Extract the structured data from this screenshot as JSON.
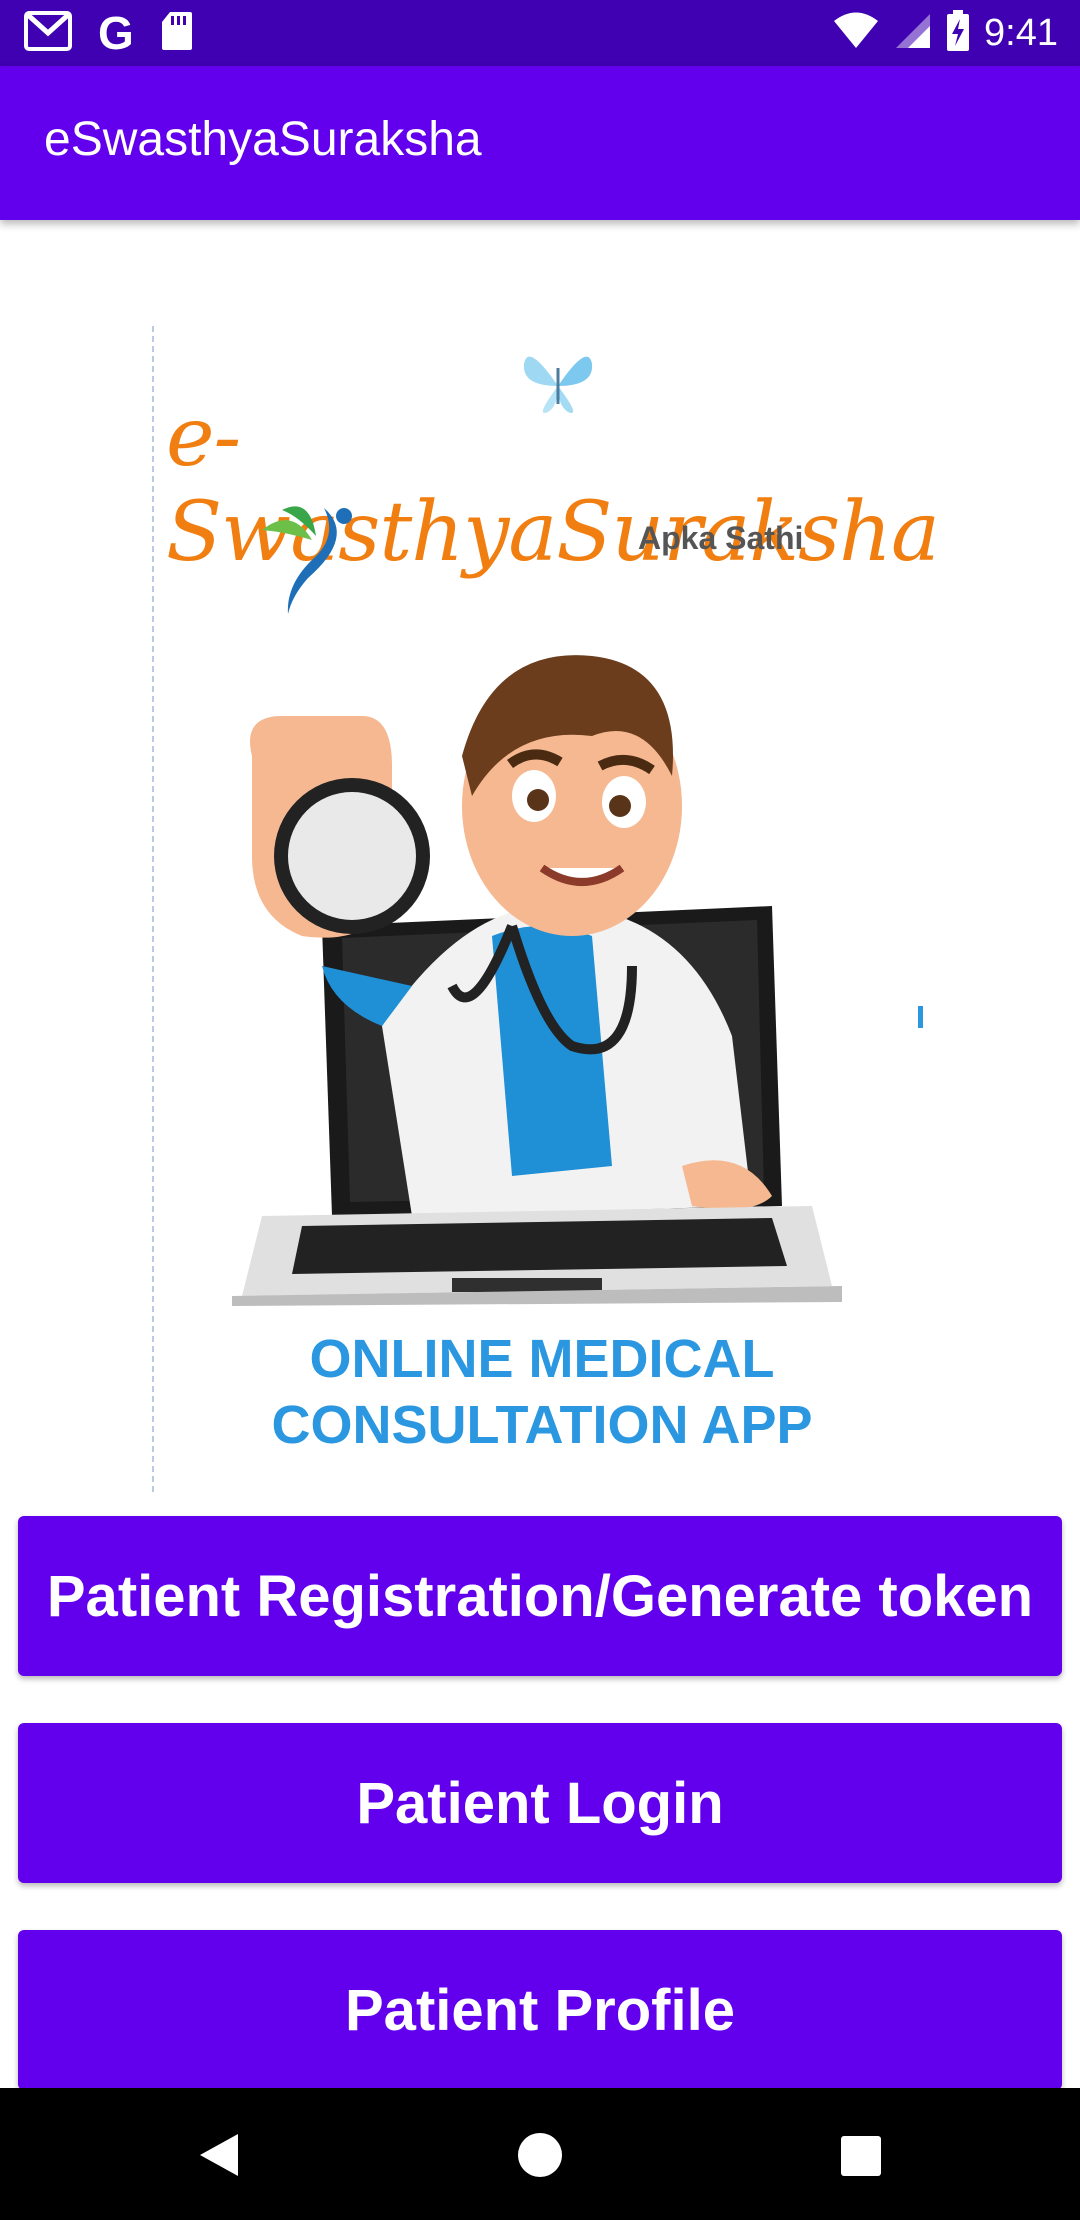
{
  "status_bar": {
    "time": "9:41",
    "left_icons": [
      "gmail-icon",
      "google-icon",
      "sd-card-icon"
    ],
    "right_icons": [
      "wifi-icon",
      "signal-icon",
      "battery-charging-icon"
    ]
  },
  "app_bar": {
    "title": "eSwasthyaSuraksha"
  },
  "splash": {
    "brand": "e-SwasthyaSuraksha",
    "tagline": "Apka Sathi",
    "caption_line1": "ONLINE MEDICAL",
    "caption_line2": "CONSULTATION APP",
    "brand_color": "#f07e10",
    "caption_color": "#2a97e0"
  },
  "buttons": {
    "registration": "Patient Registration/Generate token",
    "login": "Patient Login",
    "profile": "Patient Profile"
  },
  "nav_bar": {
    "icons": [
      "back-icon",
      "home-icon",
      "recents-icon"
    ]
  },
  "colors": {
    "primary": "#6200ee",
    "status_bar": "#3f01b1"
  }
}
